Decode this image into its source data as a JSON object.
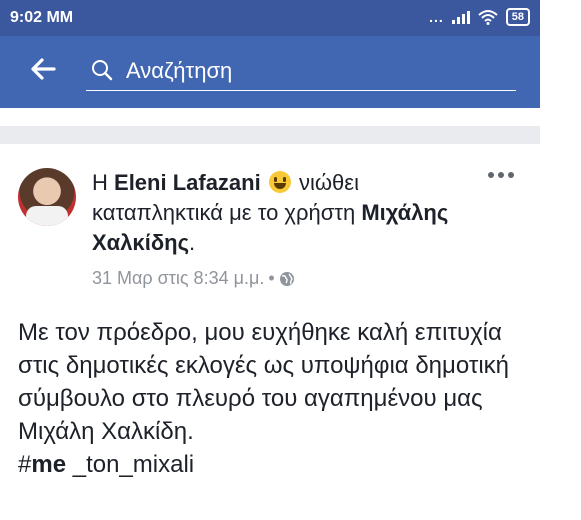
{
  "status_bar": {
    "time": "9:02 MM",
    "dots": "...",
    "battery": "58"
  },
  "search": {
    "placeholder": "Αναζήτηση"
  },
  "post": {
    "prefix": "Η",
    "author": "Eleni Lafazani",
    "feeling_text": "νιώθει καταπληκτικά με το χρήστη",
    "tagged_user": "Μιχάλης Χαλκίδης",
    "tagged_suffix": ".",
    "timestamp": "31 Μαρ στις 8:34 μ.μ.",
    "separator": "•",
    "body": "Με τον πρόεδρο, μου ευχήθηκε καλή επιτυχία στις δημοτικές εκλογές ως υποψήφια δημοτική σύμβουλο στο πλευρό του αγαπημένου μας Μιχάλη Χαλκίδη.",
    "hashtag_prefix": "#",
    "hashtag_bold": "me",
    "hashtag_rest": " _ton_mixali"
  },
  "colors": {
    "status_bar": "#3b579d",
    "search_bar": "#4267b2",
    "separator": "#e9ebee",
    "meta_text": "#90949c"
  },
  "icons": [
    "back-arrow-icon",
    "search-icon",
    "more-options-icon",
    "globe-icon",
    "wifi-icon",
    "signal-icon",
    "smiley-emoji-icon"
  ]
}
